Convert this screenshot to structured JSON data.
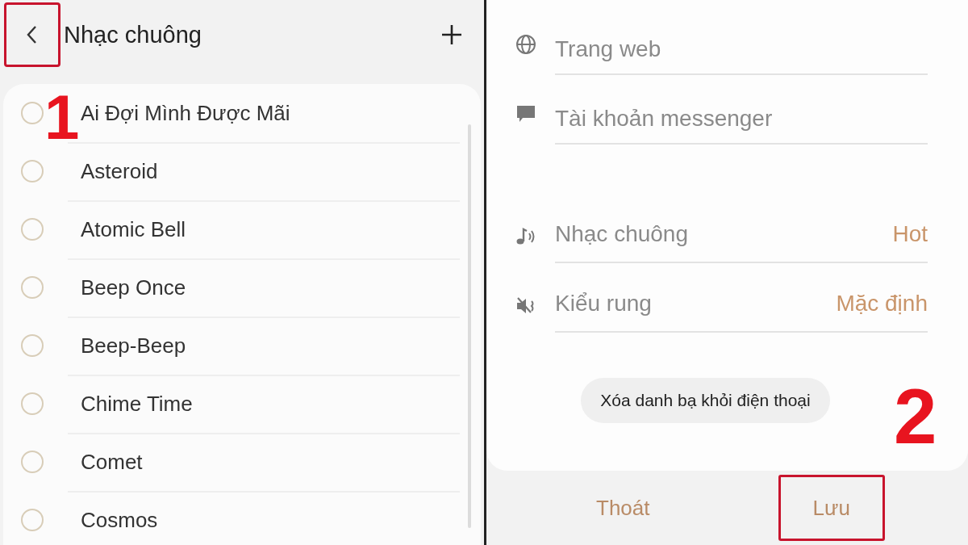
{
  "ringtone_screen": {
    "back_button": {
      "highlighted": true
    },
    "title": "Nhạc chuông",
    "ringtones": [
      {
        "name": "Ai Đợi Mình Được Mãi",
        "selected": false
      },
      {
        "name": "Asteroid",
        "selected": false
      },
      {
        "name": "Atomic Bell",
        "selected": false
      },
      {
        "name": "Beep Once",
        "selected": false
      },
      {
        "name": "Beep-Beep",
        "selected": false
      },
      {
        "name": "Chime Time",
        "selected": false
      },
      {
        "name": "Comet",
        "selected": false
      },
      {
        "name": "Cosmos",
        "selected": false
      }
    ]
  },
  "contact_screen": {
    "fields": [
      {
        "kind": "web",
        "placeholder": "Trang web"
      },
      {
        "kind": "messenger",
        "placeholder": "Tài khoản messenger"
      }
    ],
    "settings": [
      {
        "kind": "ringtone",
        "label": "Nhạc chuông",
        "value": "Hot"
      },
      {
        "kind": "vibration",
        "label": "Kiểu rung",
        "value": "Mặc định"
      }
    ],
    "delete_button": "Xóa danh bạ khỏi điện thoại",
    "actions": [
      {
        "label": "Thoát",
        "highlighted": false
      },
      {
        "label": "Lưu",
        "highlighted": true
      }
    ]
  },
  "step_labels": [
    "1",
    "2"
  ]
}
